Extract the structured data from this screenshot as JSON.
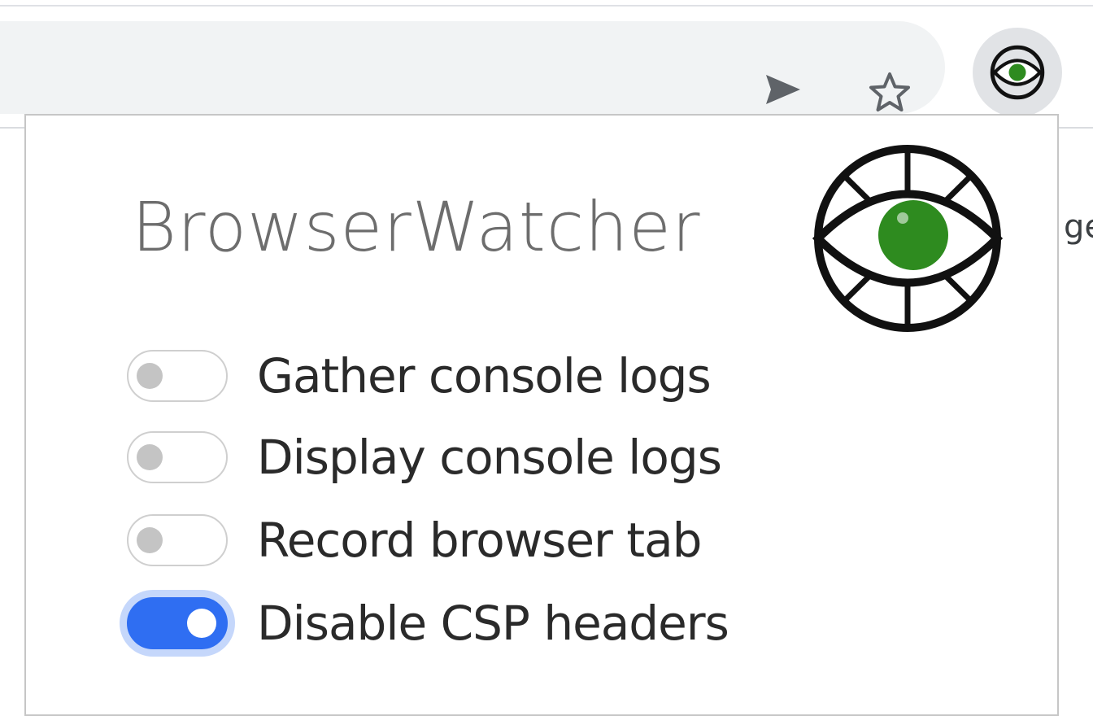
{
  "browser": {
    "send_icon": "send-icon",
    "bookmark_icon": "star-icon",
    "extension_icon": "browserwatcher-eye-icon",
    "background_text": "ge"
  },
  "popup": {
    "title": "BrowserWatcher",
    "logo_icon": "eye-icon",
    "colors": {
      "eye_green": "#2e8b1f",
      "toggle_on": "#2f6ef2",
      "toggle_focus_ring": "#c5d7fb",
      "toggle_off_knob": "#c4c4c4"
    },
    "options": [
      {
        "label": "Gather console logs",
        "enabled": false
      },
      {
        "label": "Display console logs",
        "enabled": false
      },
      {
        "label": "Record browser tab",
        "enabled": false
      },
      {
        "label": "Disable CSP headers",
        "enabled": true
      }
    ]
  }
}
